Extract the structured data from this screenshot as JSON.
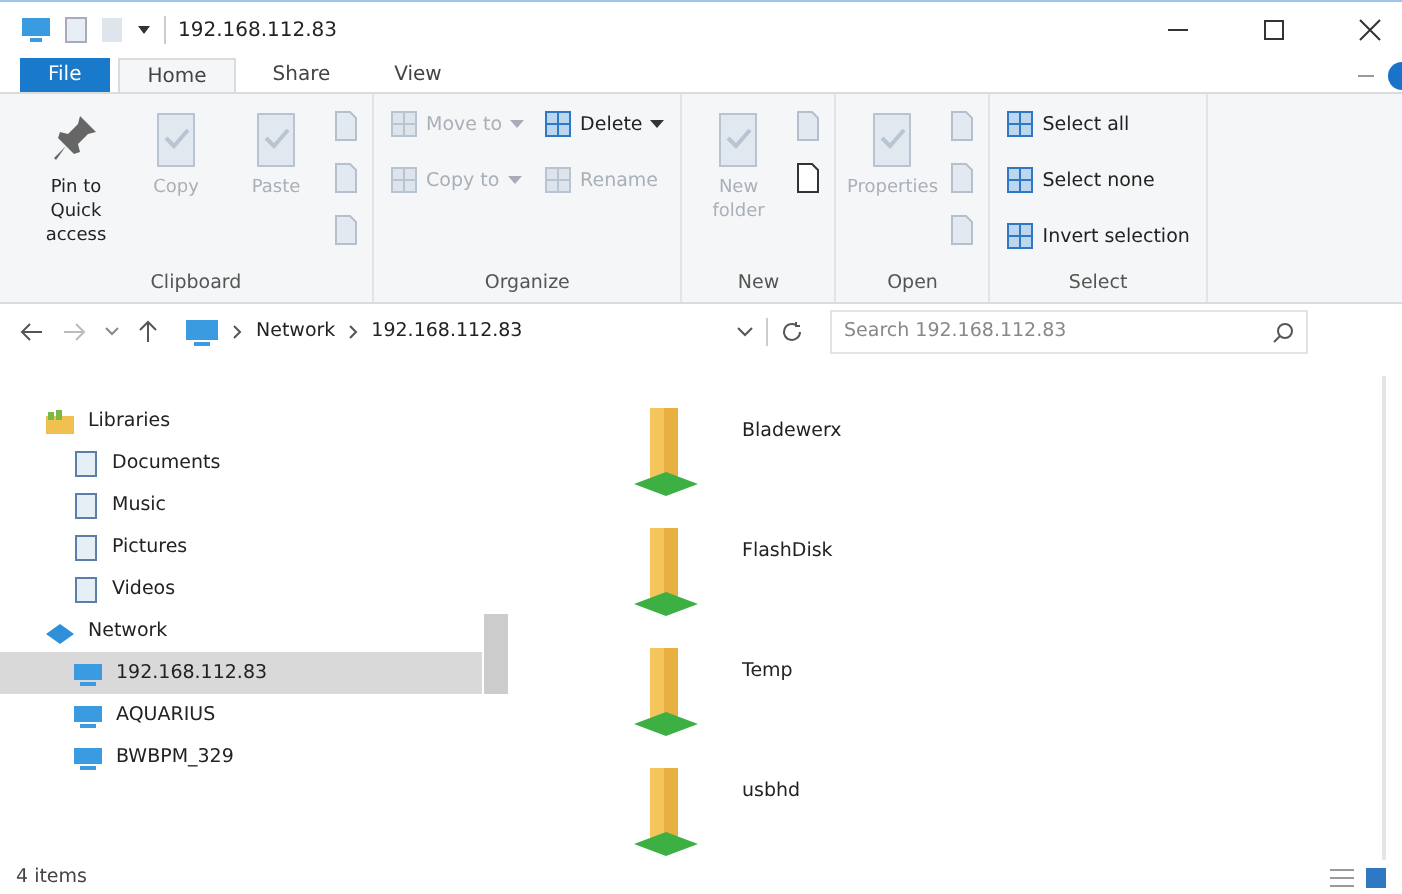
{
  "window": {
    "title": "192.168.112.83"
  },
  "tabs": [
    {
      "label": "File",
      "kind": "file",
      "selected": false
    },
    {
      "label": "Home",
      "kind": "tab",
      "selected": true
    },
    {
      "label": "Share",
      "kind": "tab",
      "selected": false
    },
    {
      "label": "View",
      "kind": "tab",
      "selected": false
    }
  ],
  "ribbon": {
    "groups": [
      {
        "label": "Clipboard",
        "columns": [
          [
            {
              "kind": "large",
              "label": "Pin to Quick access",
              "disabled": false
            }
          ],
          [
            {
              "kind": "large",
              "label": "Copy",
              "disabled": true
            }
          ],
          [
            {
              "kind": "large",
              "label": "Paste",
              "disabled": true
            }
          ],
          [
            {
              "kind": "icon",
              "disabled": true
            },
            {
              "kind": "icon",
              "disabled": true
            },
            {
              "kind": "icon",
              "disabled": true
            }
          ]
        ]
      },
      {
        "label": "Organize",
        "columns": [
          [
            {
              "kind": "small",
              "label": "Move to",
              "dropdown": true,
              "disabled": true
            },
            {
              "kind": "small",
              "label": "Copy to",
              "dropdown": true,
              "disabled": true
            }
          ],
          [
            {
              "kind": "small",
              "label": "Delete",
              "dropdown": true,
              "disabled": false
            },
            {
              "kind": "small",
              "label": "Rename",
              "dropdown": false,
              "disabled": true
            }
          ]
        ]
      },
      {
        "label": "New",
        "columns": [
          [
            {
              "kind": "large",
              "label": "New folder",
              "disabled": true
            }
          ],
          [
            {
              "kind": "icon",
              "disabled": true
            },
            {
              "kind": "icon",
              "disabled": false
            }
          ]
        ]
      },
      {
        "label": "Open",
        "columns": [
          [
            {
              "kind": "large",
              "label": "Properties",
              "disabled": true
            }
          ],
          [
            {
              "kind": "icon",
              "disabled": true
            },
            {
              "kind": "icon",
              "disabled": true
            },
            {
              "kind": "icon",
              "disabled": true
            }
          ]
        ]
      },
      {
        "label": "Select",
        "columns": [
          [
            {
              "kind": "small",
              "label": "Select all",
              "dropdown": false,
              "disabled": false
            },
            {
              "kind": "small",
              "label": "Select none",
              "dropdown": false,
              "disabled": false
            },
            {
              "kind": "small",
              "label": "Invert selection",
              "dropdown": false,
              "disabled": false
            }
          ]
        ]
      }
    ]
  },
  "address": {
    "path": [
      "Network",
      "192.168.112.83"
    ]
  },
  "search": {
    "placeholder": "Search 192.168.112.83"
  },
  "sidebar": {
    "items": [
      {
        "label": "Libraries",
        "selected": false,
        "children": [
          {
            "label": "Documents",
            "selected": false
          },
          {
            "label": "Music",
            "selected": false
          },
          {
            "label": "Pictures",
            "selected": false
          },
          {
            "label": "Videos",
            "selected": false
          }
        ]
      },
      {
        "label": "Network",
        "selected": false,
        "children": [
          {
            "label": "192.168.112.83",
            "selected": true
          },
          {
            "label": "AQUARIUS",
            "selected": false
          },
          {
            "label": "BWBPM_329",
            "selected": false
          }
        ]
      }
    ]
  },
  "files": [
    {
      "name": "Bladewerx"
    },
    {
      "name": "FlashDisk"
    },
    {
      "name": "Temp"
    },
    {
      "name": "usbhd"
    }
  ],
  "status_bar": {
    "count": "4 items"
  }
}
